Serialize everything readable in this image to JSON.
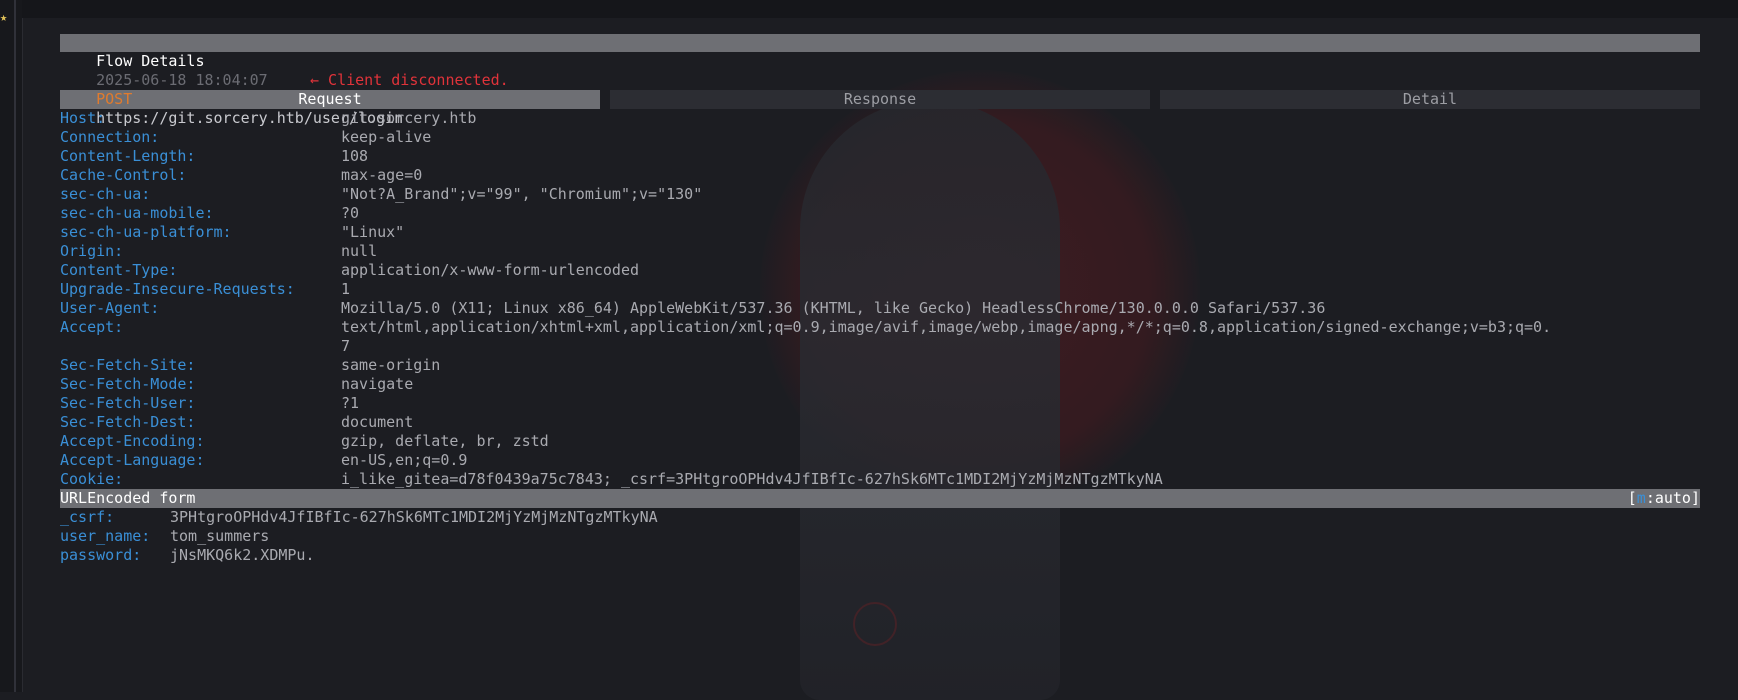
{
  "flow": {
    "title": "Flow Details",
    "timestamp": "2025-06-18 18:04:07",
    "method": "POST",
    "url": "https://git.sorcery.htb/user/login",
    "status": "← Client disconnected."
  },
  "tabs": [
    {
      "label": "Request",
      "active": true
    },
    {
      "label": "Response",
      "active": false
    },
    {
      "label": "Detail",
      "active": false
    }
  ],
  "headers": [
    {
      "key": "Host:",
      "value": "git.sorcery.htb"
    },
    {
      "key": "Connection:",
      "value": "keep-alive"
    },
    {
      "key": "Content-Length:",
      "value": "108"
    },
    {
      "key": "Cache-Control:",
      "value": "max-age=0"
    },
    {
      "key": "sec-ch-ua:",
      "value": "\"Not?A_Brand\";v=\"99\", \"Chromium\";v=\"130\""
    },
    {
      "key": "sec-ch-ua-mobile:",
      "value": "?0"
    },
    {
      "key": "sec-ch-ua-platform:",
      "value": "\"Linux\""
    },
    {
      "key": "Origin:",
      "value": "null"
    },
    {
      "key": "Content-Type:",
      "value": "application/x-www-form-urlencoded"
    },
    {
      "key": "Upgrade-Insecure-Requests:",
      "value": "1"
    },
    {
      "key": "User-Agent:",
      "value": "Mozilla/5.0 (X11; Linux x86_64) AppleWebKit/537.36 (KHTML, like Gecko) HeadlessChrome/130.0.0.0 Safari/537.36"
    },
    {
      "key": "Accept:",
      "value": "text/html,application/xhtml+xml,application/xml;q=0.9,image/avif,image/webp,image/apng,*/*;q=0.8,application/signed-exchange;v=b3;q=0.",
      "cont": "7"
    },
    {
      "key": "Sec-Fetch-Site:",
      "value": "same-origin"
    },
    {
      "key": "Sec-Fetch-Mode:",
      "value": "navigate"
    },
    {
      "key": "Sec-Fetch-User:",
      "value": "?1"
    },
    {
      "key": "Sec-Fetch-Dest:",
      "value": "document"
    },
    {
      "key": "Accept-Encoding:",
      "value": "gzip, deflate, br, zstd"
    },
    {
      "key": "Accept-Language:",
      "value": "en-US,en;q=0.9"
    },
    {
      "key": "Cookie:",
      "value": "i_like_gitea=d78f0439a75c7843; _csrf=3PHtgroOPHdv4JfIBfIc-627hSk6MTc1MDI2MjYzMjMzNTgzMTkyNA"
    }
  ],
  "form": {
    "title": "URLEncoded form",
    "mode_prefix": "[",
    "mode_key": "m",
    "mode_suffix": ":auto]",
    "fields": [
      {
        "key": "_csrf:",
        "value": "3PHtgroOPHdv4JfIBfIc-627hSk6MTc1MDI2MjYzMjMzNTgzMTkyNA"
      },
      {
        "key": "user_name:",
        "value": "tom_summers"
      },
      {
        "key": "password:",
        "value": "jNsMKQ6k2.XDMPu."
      }
    ]
  },
  "icons": {
    "gutter": "star-icon"
  },
  "colors": {
    "background": "#1c1d22",
    "header_key": "#3a8fd6",
    "method": "#e07b2e",
    "error": "#e0333a",
    "bar": "#6e6f74"
  }
}
